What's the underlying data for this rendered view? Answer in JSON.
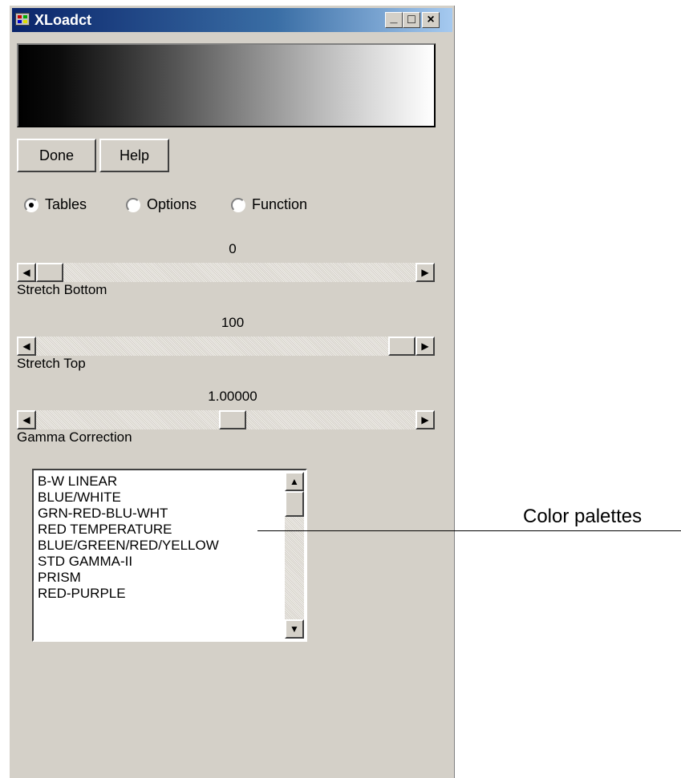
{
  "window": {
    "title": "XLoadct"
  },
  "titlebar_buttons": {
    "minimize": "_",
    "maximize": "□",
    "close": "×"
  },
  "buttons": {
    "done": "Done",
    "help": "Help"
  },
  "radios": [
    {
      "label": "Tables",
      "checked": true
    },
    {
      "label": "Options",
      "checked": false
    },
    {
      "label": "Function",
      "checked": false
    }
  ],
  "sliders": {
    "stretch_bottom": {
      "value_text": "0",
      "label": "Stretch Bottom",
      "value": 0,
      "min": 0,
      "max": 100
    },
    "stretch_top": {
      "value_text": "100",
      "label": "Stretch Top",
      "value": 100,
      "min": 0,
      "max": 100
    },
    "gamma": {
      "value_text": "1.00000",
      "label": "Gamma Correction"
    }
  },
  "palette_list": {
    "items": [
      "B-W LINEAR",
      "BLUE/WHITE",
      "GRN-RED-BLU-WHT",
      "RED TEMPERATURE",
      "BLUE/GREEN/RED/YELLOW",
      "STD GAMMA-II",
      "PRISM",
      "RED-PURPLE"
    ]
  },
  "annotation": {
    "text": "Color palettes"
  },
  "icons": {
    "app": "app-icon",
    "scroll_left": "◀",
    "scroll_right": "▶",
    "scroll_up": "▲",
    "scroll_down": "▼"
  },
  "colors": {
    "titlebar_start": "#0a246a",
    "titlebar_end": "#a6caf0",
    "window_bg": "#d4d0c8"
  }
}
